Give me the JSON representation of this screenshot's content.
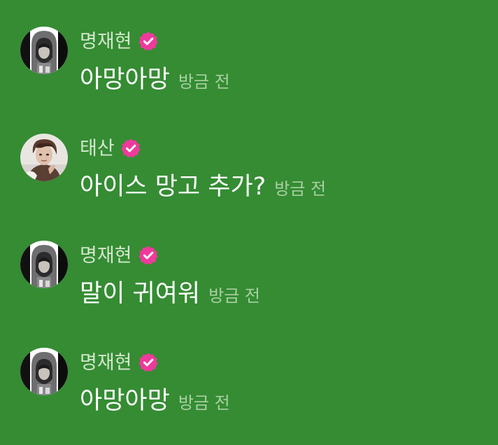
{
  "messages": [
    {
      "username": "명재현",
      "verified_icon": "verified-badge-icon",
      "avatar": "hooded-figure",
      "text": "아망아망",
      "timestamp": "방금 전"
    },
    {
      "username": "태산",
      "verified_icon": "verified-badge-icon",
      "avatar": "brown-hair-figure",
      "text": "아이스 망고 추가?",
      "timestamp": "방금 전"
    },
    {
      "username": "명재현",
      "verified_icon": "verified-badge-icon",
      "avatar": "hooded-figure",
      "text": "말이 귀여워",
      "timestamp": "방금 전"
    },
    {
      "username": "명재현",
      "verified_icon": "verified-badge-icon",
      "avatar": "hooded-figure",
      "text": "아망아망",
      "timestamp": "방금 전"
    }
  ],
  "colors": {
    "background": "#358c33",
    "username": "#d3e7cd",
    "message": "#ffffff",
    "timestamp": "#a9cfa2",
    "verified_badge": "#ee3a9c"
  }
}
